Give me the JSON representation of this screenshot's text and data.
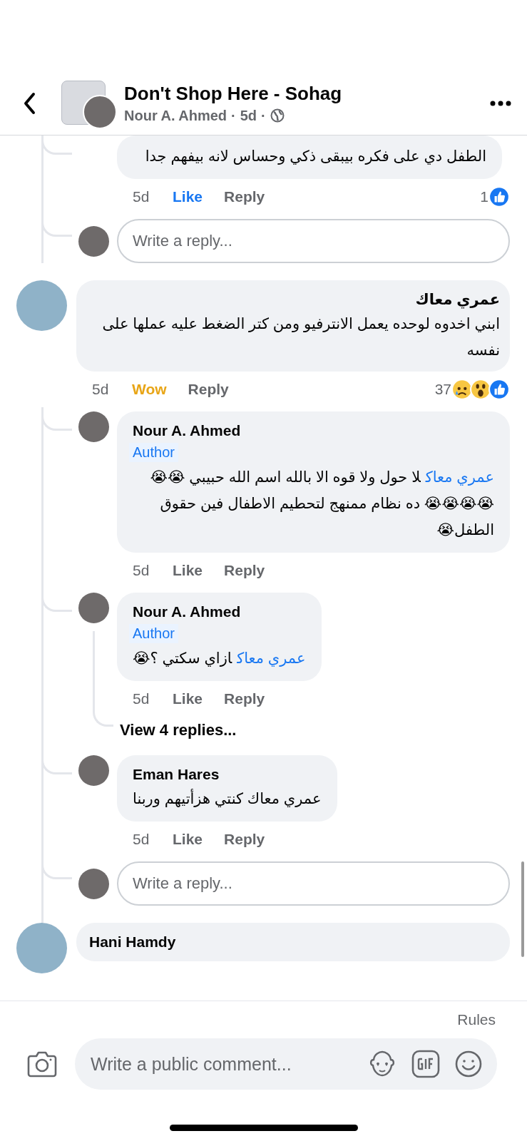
{
  "header": {
    "title": "Don't Shop Here - Sohag",
    "author": "Nour A. Ahmed",
    "separator_1": "·",
    "time": "5d",
    "separator_2": "·"
  },
  "previous_thread": {
    "replies": [
      {
        "text": "الطفل دي على فكره بيبقى ذكي وحساس لانه بيفهم جدا",
        "time": "5d",
        "reaction_button": {
          "label": "Like",
          "selected": true
        },
        "reply_button": "Reply",
        "count": "1",
        "reactions": [
          {
            "kind": "like"
          }
        ]
      }
    ],
    "reply_placeholder": "Write a reply..."
  },
  "comments": [
    {
      "author": "عمري معاك",
      "text": "ابني اخدوه لوحده يعمل الانترفيو ومن كتر الضغط عليه عملها على نفسه",
      "time": "5d",
      "reaction_button": {
        "label": "Wow",
        "kind": "wow",
        "selected": true
      },
      "reply_button": "Reply",
      "count": "37",
      "reactions": [
        {
          "kind": "sad"
        },
        {
          "kind": "wow"
        },
        {
          "kind": "like"
        }
      ],
      "replies": [
        {
          "author": "Nour A. Ahmed",
          "badge": "Author",
          "mention": "عمري معاك",
          "text": "لا حول ولا قوه الا بالله اسم الله حبيبي 😭😭😭😭😭😭 ده نظام ممنهج لتحطيم الاطفال فين حقوق الطفل😭",
          "time": "5d",
          "reaction_button": {
            "label": "Like",
            "selected": false
          },
          "reply_button": "Reply"
        },
        {
          "author": "Nour A. Ahmed",
          "badge": "Author",
          "mention": "عمري معاك",
          "text": "ازاي سكتي ؟😭",
          "time": "5d",
          "reaction_button": {
            "label": "Like",
            "selected": false
          },
          "reply_button": "Reply",
          "more_replies": "View 4 replies..."
        },
        {
          "author": "Eman Hares",
          "text": "عمري معاك كنتي هزأتيهم وربنا",
          "time": "5d",
          "reaction_button": {
            "label": "Like",
            "selected": false
          },
          "reply_button": "Reply"
        }
      ],
      "reply_placeholder": "Write a reply..."
    },
    {
      "author": "Hani Hamdy"
    }
  ],
  "composer": {
    "rules": "Rules",
    "placeholder": "Write a public comment..."
  }
}
